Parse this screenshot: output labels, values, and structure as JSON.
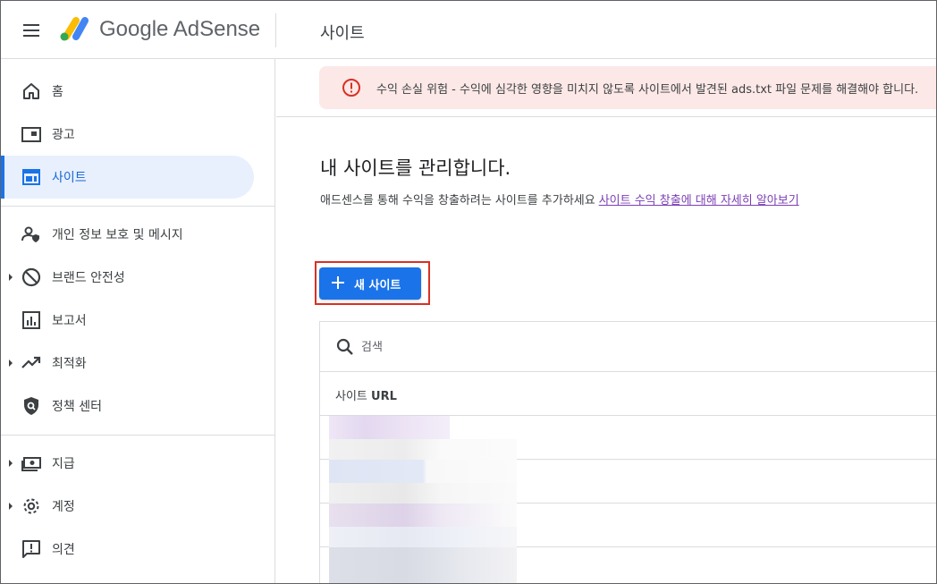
{
  "header": {
    "app_name": "Google AdSense",
    "page_title": "사이트"
  },
  "sidebar": {
    "items": [
      {
        "label": "홈",
        "icon": "home-icon"
      },
      {
        "label": "광고",
        "icon": "ads-icon"
      },
      {
        "label": "사이트",
        "icon": "sites-icon",
        "active": true
      },
      {
        "label": "개인 정보 보호 및 메시지",
        "icon": "privacy-icon"
      },
      {
        "label": "브랜드 안전성",
        "icon": "block-icon",
        "expandable": true
      },
      {
        "label": "보고서",
        "icon": "reports-icon"
      },
      {
        "label": "최적화",
        "icon": "trending-icon",
        "expandable": true
      },
      {
        "label": "정책 센터",
        "icon": "shield-icon"
      },
      {
        "label": "지급",
        "icon": "payments-icon",
        "expandable": true
      },
      {
        "label": "계정",
        "icon": "gear-icon",
        "expandable": true
      },
      {
        "label": "의견",
        "icon": "feedback-icon"
      }
    ]
  },
  "alert": {
    "icon": "error-icon",
    "text": "수익 손실 위험 - 수익에 심각한 영향을 미치지 않도록 사이트에서 발견된 ads.txt 파일 문제를 해결해야 합니다."
  },
  "main": {
    "title": "내 사이트를 관리합니다.",
    "description": "애드센스를 통해 수익을 창출하려는 사이트를 추가하세요",
    "learn_more_link": "사이트 수익 창출에 대해 자세히 알아보기",
    "new_site_button": "새 사이트",
    "search_placeholder": "검색",
    "column_header_prefix": "사이트",
    "column_header_bold": "URL",
    "rows_visible": 4
  },
  "colors": {
    "accent": "#1a73e8",
    "active_bg": "#e8f0fe",
    "alert_bg": "#fce8e6",
    "alert_icon": "#d93025",
    "link": "#7b3fb5"
  }
}
